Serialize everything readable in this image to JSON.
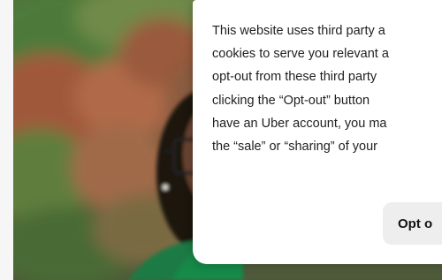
{
  "consent": {
    "lines": [
      "This website uses third party a",
      "cookies to serve you relevant a",
      "opt-out from these third party",
      "clicking the “Opt-out” button",
      "have an Uber account, you ma",
      "the “sale” or “sharing” of your"
    ],
    "optout_label": "Opt o"
  },
  "colors": {
    "card_background": "#ffffff",
    "button_background": "#eeeeee",
    "text": "#1f1f1f",
    "jacket_green": "#1f7a45"
  }
}
